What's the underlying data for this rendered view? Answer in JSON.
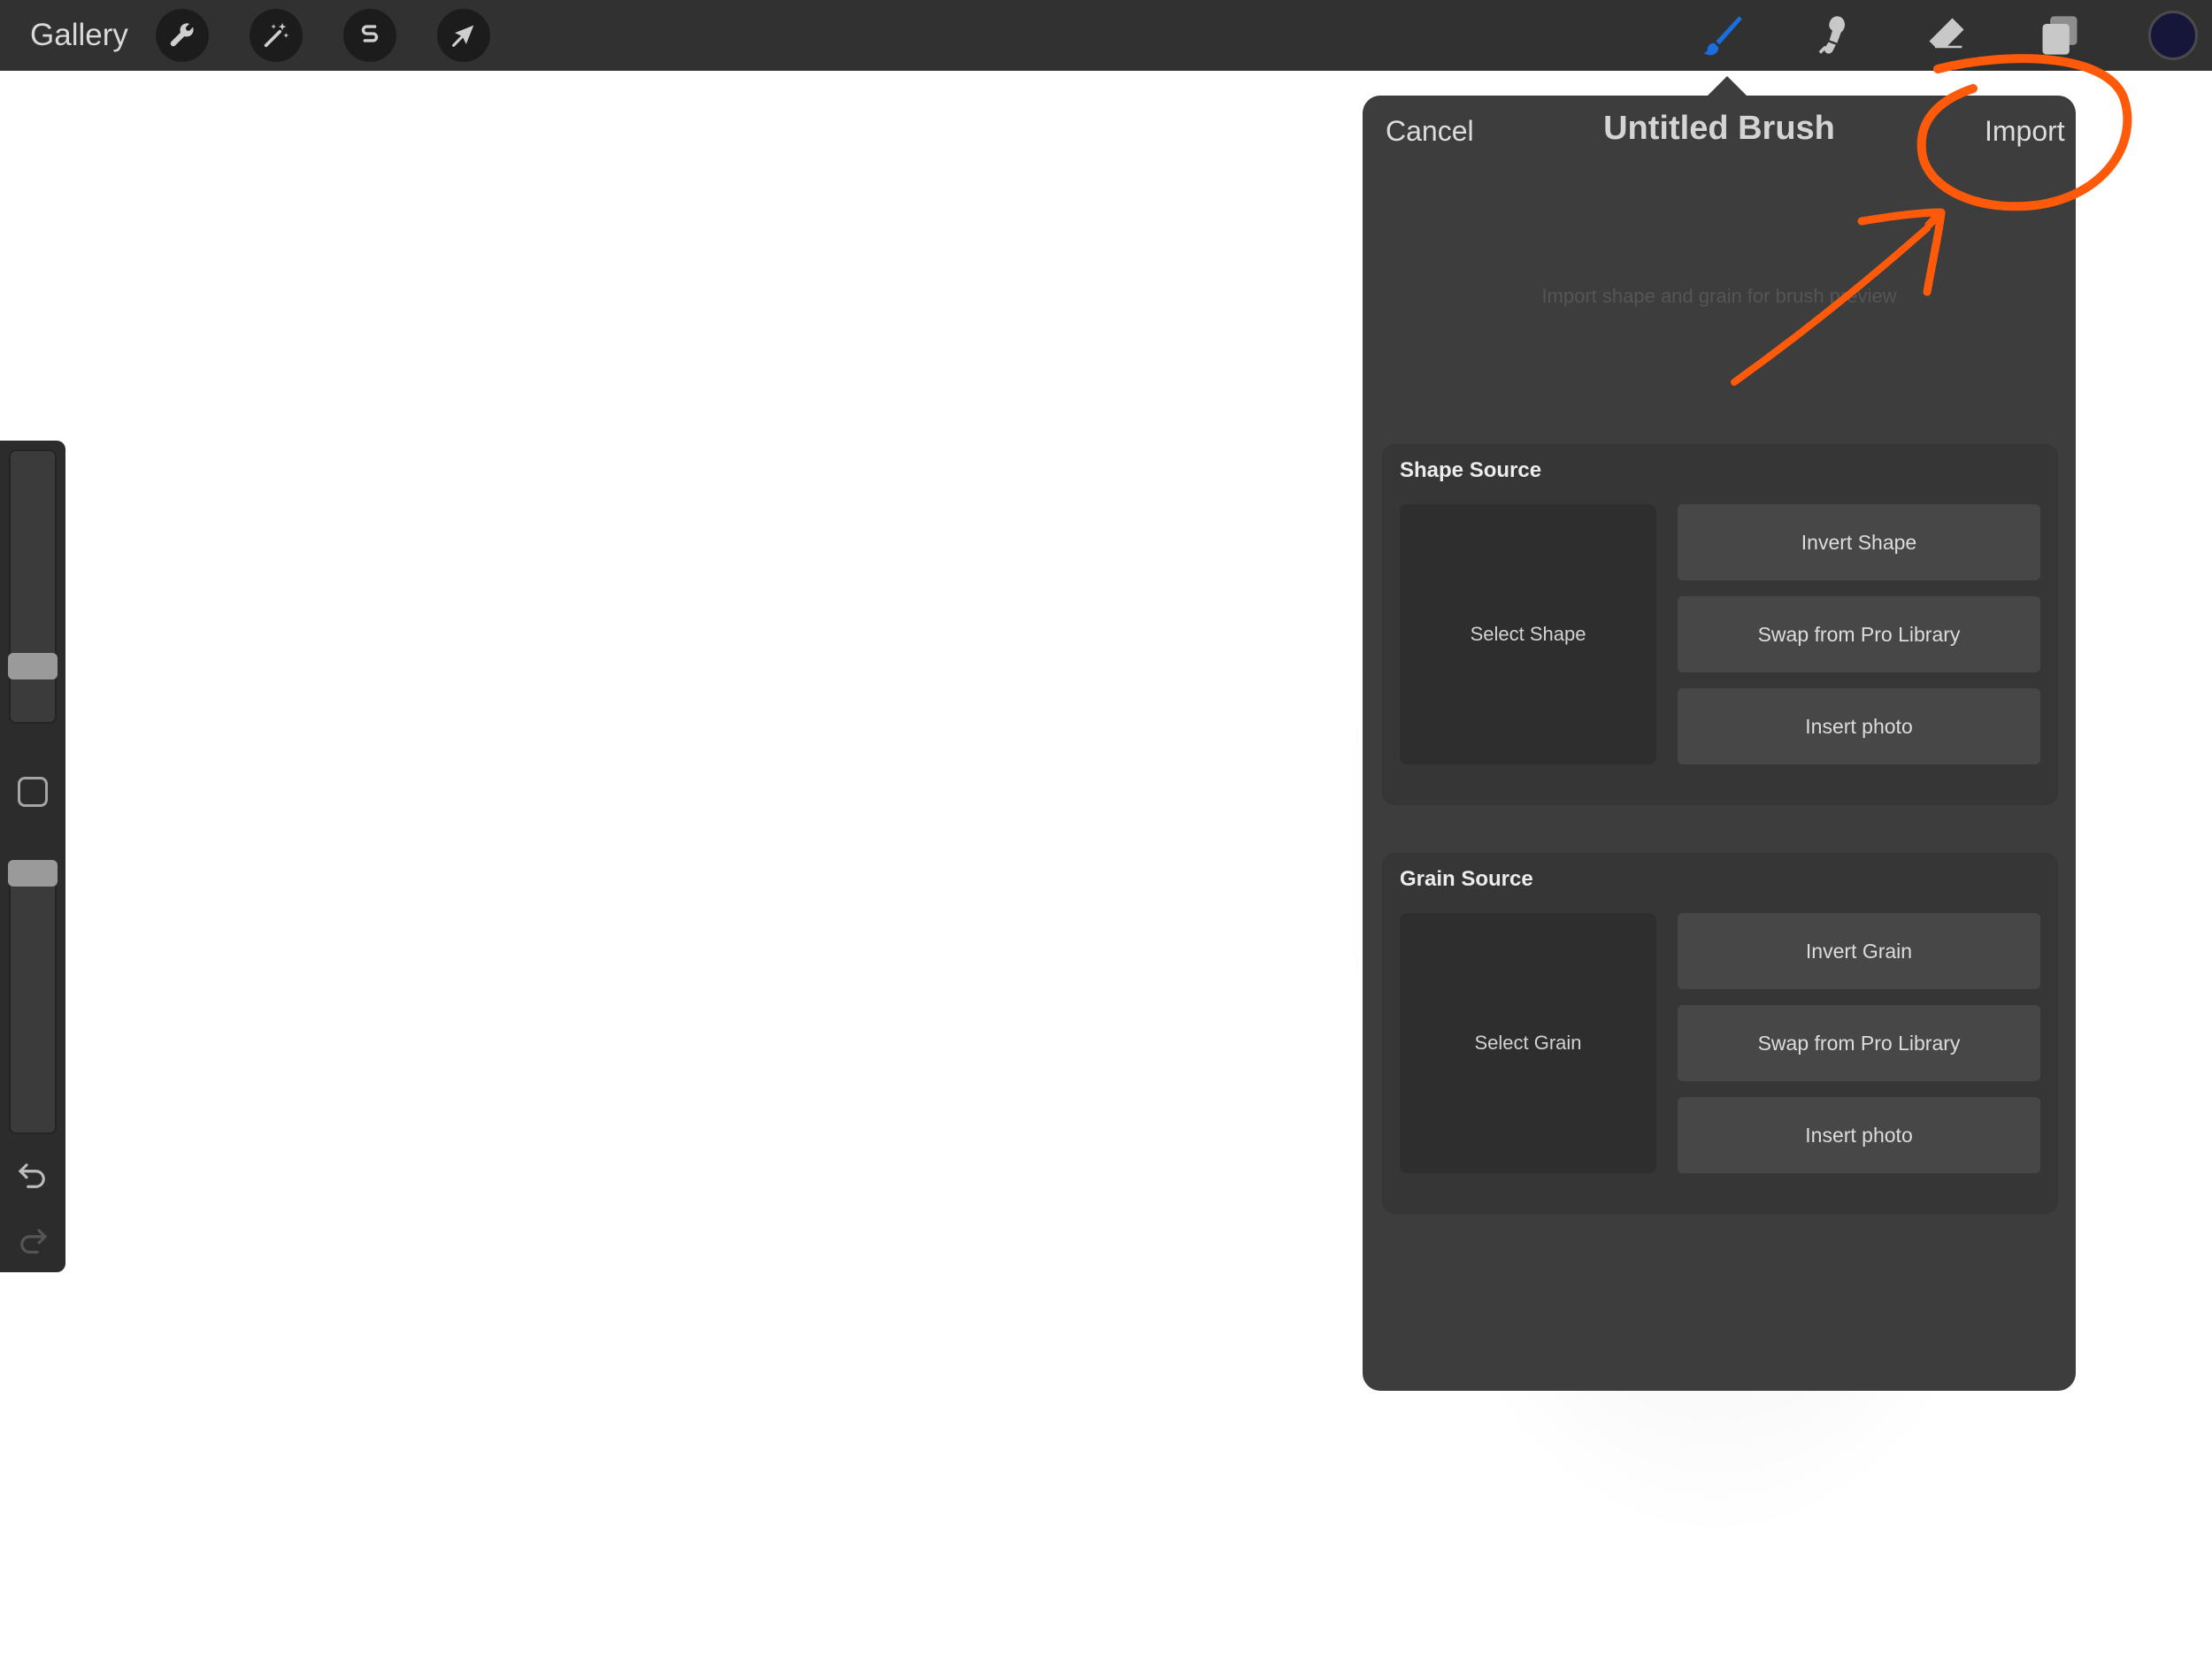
{
  "toolbar": {
    "gallery_label": "Gallery",
    "left_tools": [
      {
        "name": "wrench-icon",
        "label": "Actions"
      },
      {
        "name": "magic-wand-icon",
        "label": "Adjustments"
      },
      {
        "name": "selection-icon",
        "label": "Selection"
      },
      {
        "name": "transform-arrow-icon",
        "label": "Transform"
      }
    ],
    "right_tools": [
      {
        "name": "brush-icon",
        "active": true
      },
      {
        "name": "smudge-icon",
        "active": false
      },
      {
        "name": "eraser-icon",
        "active": false
      },
      {
        "name": "layers-icon",
        "active": false
      }
    ],
    "current_color": "#16163a",
    "active_color": "#1a6fe0"
  },
  "sidebar": {
    "size_slider_value": 0.18,
    "opacity_slider_value": 1.0,
    "icons": [
      "modify-button-icon",
      "undo-icon",
      "redo-icon"
    ]
  },
  "panel": {
    "cancel_label": "Cancel",
    "title": "Untitled Brush",
    "import_label": "Import",
    "hint": "Import shape and grain for brush preview",
    "shape_source": {
      "title": "Shape Source",
      "select_label": "Select Shape",
      "buttons": [
        "Invert Shape",
        "Swap from Pro Library",
        "Insert photo"
      ]
    },
    "grain_source": {
      "title": "Grain Source",
      "select_label": "Select Grain",
      "buttons": [
        "Invert Grain",
        "Swap from Pro Library",
        "Insert photo"
      ]
    }
  },
  "annotation": {
    "color": "#ff5a0a"
  }
}
